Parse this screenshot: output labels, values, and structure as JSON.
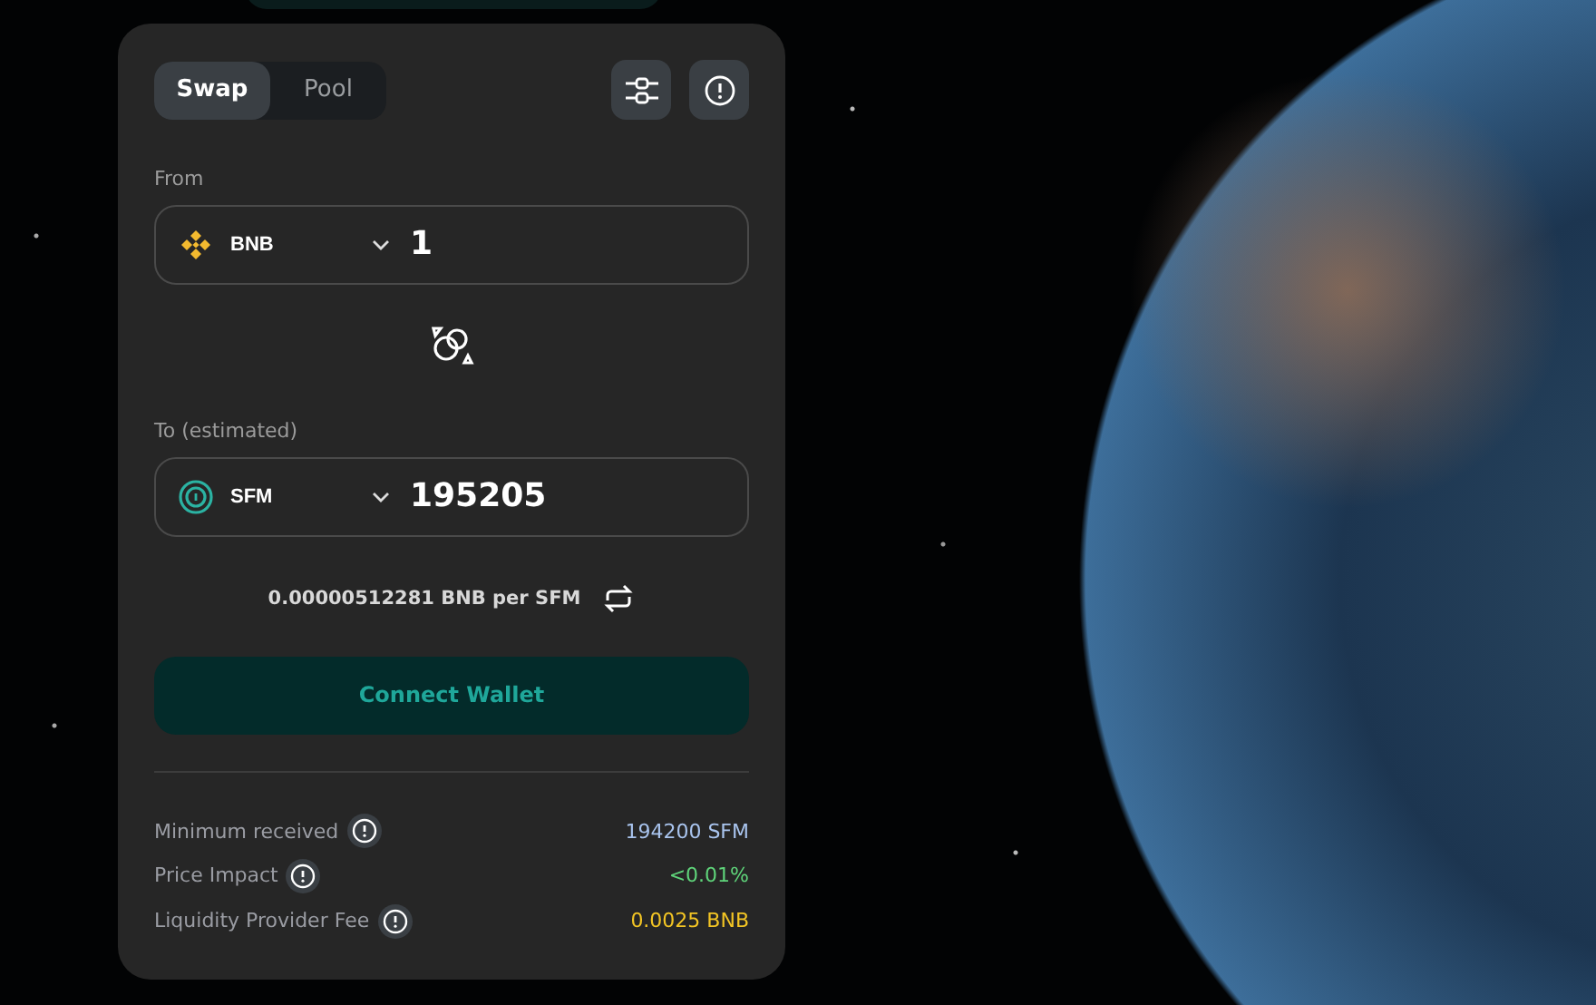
{
  "tabs": [
    {
      "label": "Swap",
      "selected": true
    },
    {
      "label": "Pool",
      "selected": false
    }
  ],
  "from": {
    "label": "From",
    "token": {
      "kind": "bnb",
      "symbol": "BNB"
    },
    "amount": "1"
  },
  "to": {
    "label": "To (estimated)",
    "token": {
      "kind": "sfm",
      "symbol": "SFM"
    },
    "amount": "195205"
  },
  "rate": "0.00000512281 BNB per SFM",
  "connect_button": "Connect Wallet",
  "details": [
    {
      "label": "Minimum received",
      "value": "194200 SFM",
      "color": "#a9c4ee"
    },
    {
      "label": "Price Impact",
      "value": "<0.01%",
      "color": "#5fd47a"
    },
    {
      "label": "Liquidity Provider Fee",
      "value": "0.0025 BNB",
      "color": "#f3c524"
    }
  ]
}
